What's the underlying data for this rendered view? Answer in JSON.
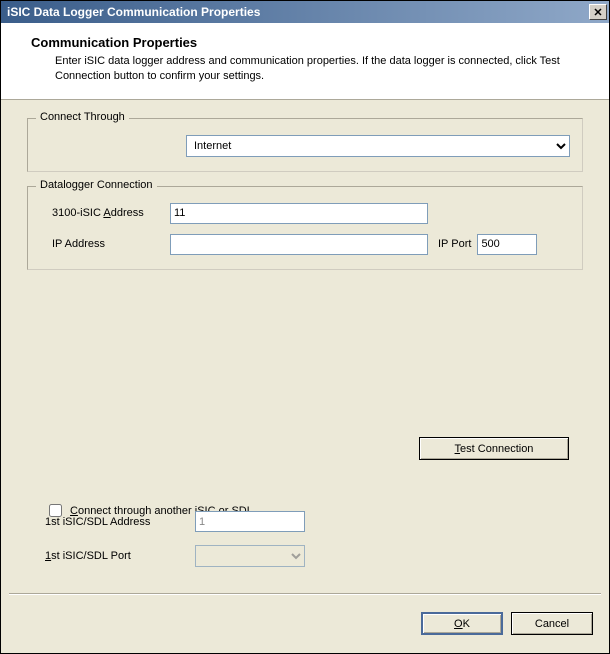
{
  "window": {
    "title": "iSIC Data Logger Communication Properties"
  },
  "header": {
    "title": "Communication Properties",
    "desc": "Enter iSIC data logger address and communication properties. If the data logger is connected, click Test Connection button to confirm your settings."
  },
  "connect": {
    "legend": "Connect Through",
    "selected": "Internet"
  },
  "datalogger": {
    "legend": "Datalogger Connection",
    "addr_label_pre": "3100-iSIC ",
    "addr_label_u": "A",
    "addr_label_post": "ddress",
    "addr_value": "11",
    "ip_label": "IP Address",
    "ip_value": "",
    "port_label": "IP Port",
    "port_value": "500"
  },
  "test_button_u": "T",
  "test_button_post": "est Connection",
  "relay": {
    "chk_u": "C",
    "chk_post": "onnect through another iSIC or SDL",
    "addr_label": "1st iSIC/SDL Address",
    "addr_value": "1",
    "port_label_u": "1",
    "port_label_post": "st iSIC/SDL Port",
    "port_value": ""
  },
  "footer": {
    "ok_u": "O",
    "ok_post": "K",
    "cancel": "Cancel"
  }
}
